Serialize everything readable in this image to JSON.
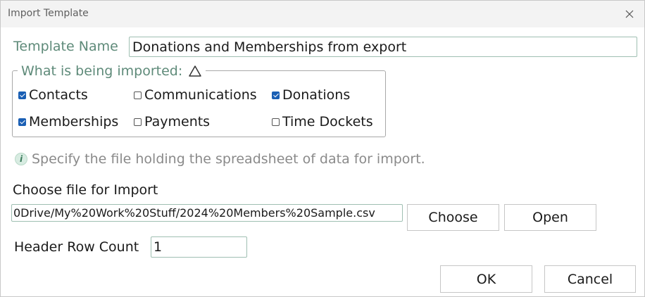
{
  "window": {
    "title": "Import Template",
    "close_icon": "close-icon"
  },
  "template": {
    "label": "Template Name",
    "value": "Donations and Memberships from export"
  },
  "imports": {
    "legend": "What is being imported:",
    "legend_icon": "warning-triangle-icon",
    "options": [
      {
        "label": "Contacts",
        "checked": true
      },
      {
        "label": "Communications",
        "checked": false
      },
      {
        "label": "Donations",
        "checked": true
      },
      {
        "label": "Memberships",
        "checked": true
      },
      {
        "label": "Payments",
        "checked": false
      },
      {
        "label": "Time Dockets",
        "checked": false
      }
    ]
  },
  "info": {
    "icon": "info-icon",
    "text": "Specify the file holding the spreadsheet of data for import."
  },
  "file": {
    "label": "Choose file for Import",
    "value": "0Drive/My%20Work%20Stuff/2024%20Members%20Sample.csv",
    "choose_label": "Choose",
    "open_label": "Open"
  },
  "header_rows": {
    "label": "Header Row Count",
    "value": "1"
  },
  "footer": {
    "ok_label": "OK",
    "cancel_label": "Cancel"
  },
  "colors": {
    "accent_label": "#5e8a79",
    "checkbox_checked": "#1a5fb4",
    "info_text": "#8a8a8a"
  }
}
